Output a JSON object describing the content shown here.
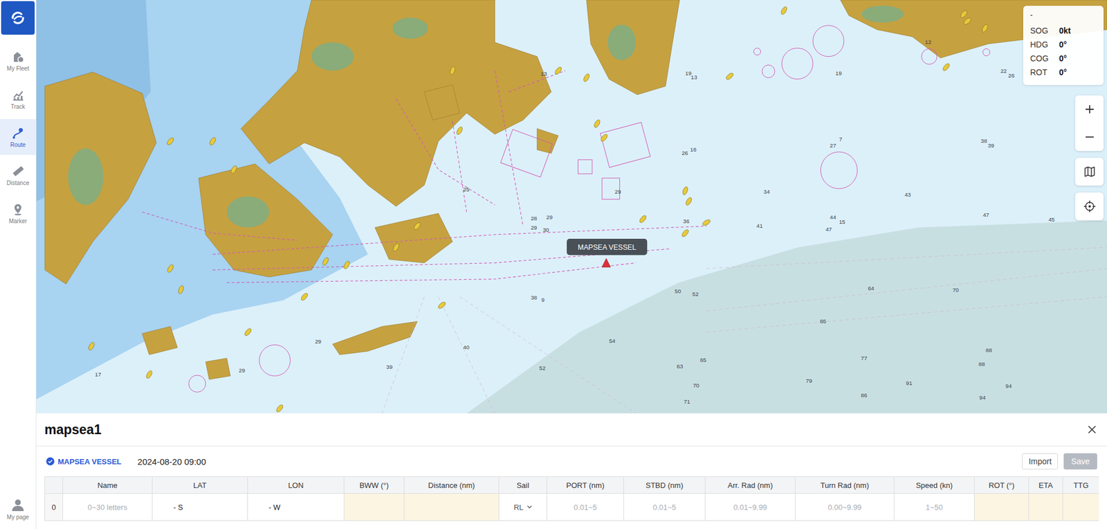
{
  "sidebar": {
    "items": [
      {
        "label": "My Fleet",
        "selected": false
      },
      {
        "label": "Track",
        "selected": false
      },
      {
        "label": "Route",
        "selected": true
      },
      {
        "label": "Distance",
        "selected": false
      },
      {
        "label": "Marker",
        "selected": false
      }
    ],
    "user": {
      "label": "My page"
    }
  },
  "map": {
    "vessel": {
      "label": "MAPSEA VESSEL"
    },
    "info": {
      "title": "-",
      "rows": [
        {
          "label": "SOG",
          "value": "0kt"
        },
        {
          "label": "HDG",
          "value": "0°"
        },
        {
          "label": "COG",
          "value": "0°"
        },
        {
          "label": "ROT",
          "value": "0°"
        }
      ]
    },
    "soundings": [
      "13",
      "19",
      "13",
      "19",
      "12",
      "22",
      "26",
      "7",
      "27",
      "26",
      "16",
      "38",
      "39",
      "34",
      "43",
      "47",
      "45",
      "44",
      "15",
      "47",
      "41",
      "36",
      "29",
      "25",
      "28",
      "29",
      "29",
      "30",
      "50",
      "52",
      "64",
      "70",
      "38",
      "9",
      "65",
      "54",
      "65",
      "77",
      "88",
      "88",
      "94",
      "63",
      "70",
      "79",
      "91",
      "86",
      "94",
      "71",
      "52",
      "40",
      "39",
      "29",
      "29",
      "17"
    ]
  },
  "route_panel": {
    "title": "mapsea1",
    "vessel": "MAPSEA VESSEL",
    "date": "2024-08-20 09:00",
    "buttons": [
      {
        "label": "Import",
        "disabled": false
      },
      {
        "label": "Save",
        "disabled": true
      }
    ],
    "table": {
      "columns": [
        "Name",
        "LAT",
        "LON",
        "BWW (°)",
        "Distance (nm)",
        "Sail",
        "PORT (nm)",
        "STBD (nm)",
        "Arr. Rad (nm)",
        "Turn Rad (nm)",
        "Speed (kn)",
        "ROT (°)",
        "ETA",
        "TTG"
      ],
      "rows": [
        {
          "index": "0",
          "cells": [
            {
              "kind": "input",
              "placeholder": "0~30 letters"
            },
            {
              "kind": "value",
              "value": "- S"
            },
            {
              "kind": "value",
              "value": "- W"
            },
            {
              "kind": "readonly"
            },
            {
              "kind": "readonly"
            },
            {
              "kind": "select",
              "value": "RL"
            },
            {
              "kind": "input",
              "placeholder": "0.01~5"
            },
            {
              "kind": "input",
              "placeholder": "0.01~5"
            },
            {
              "kind": "input",
              "placeholder": "0.01~9.99"
            },
            {
              "kind": "input",
              "placeholder": "0.00~9.99"
            },
            {
              "kind": "input",
              "placeholder": "1~50"
            },
            {
              "kind": "readonly"
            },
            {
              "kind": "readonly"
            },
            {
              "kind": "readonly"
            }
          ]
        }
      ]
    }
  }
}
